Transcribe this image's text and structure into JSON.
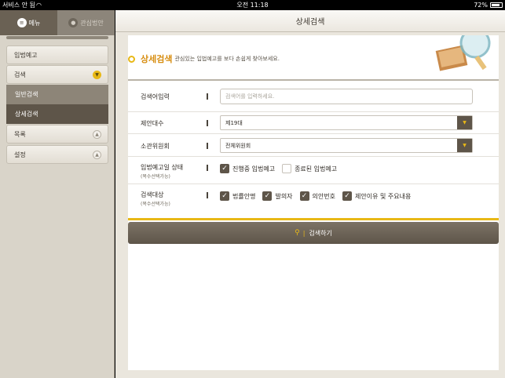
{
  "status_bar": {
    "carrier": "서비스 안 됨",
    "time": "오전 11:18",
    "battery": "72%"
  },
  "sidebar": {
    "tabs": [
      {
        "label": "메뉴",
        "icon": "list-icon"
      },
      {
        "label": "관심법안",
        "icon": "person-icon"
      }
    ],
    "items": [
      {
        "label": "입법예고"
      },
      {
        "label": "검색",
        "expanded": true
      },
      {
        "label": "목록",
        "expanded": false
      },
      {
        "label": "설정",
        "expanded": false
      }
    ],
    "sub_items": [
      {
        "label": "일반검색"
      },
      {
        "label": "상세검색",
        "selected": true
      }
    ]
  },
  "header": {
    "title": "상세검색"
  },
  "section": {
    "title": "상세검색",
    "subtitle": "관심있는 입법예고를 보다 손쉽게 찾아보세요."
  },
  "form": {
    "keyword": {
      "label": "검색어입력",
      "placeholder": "검색어를 입력하세요.",
      "value": ""
    },
    "session": {
      "label": "제안대수",
      "value": "제19대"
    },
    "committee": {
      "label": "소관위원회",
      "value": "전체위원회"
    },
    "status": {
      "label": "입법예고일 상태",
      "sublabel": "(복수선택가능)",
      "options": [
        {
          "label": "진행중 입법예고",
          "checked": true
        },
        {
          "label": "종료된 입법예고",
          "checked": false
        }
      ]
    },
    "target": {
      "label": "검색대상",
      "sublabel": "(복수선택가능)",
      "options": [
        {
          "label": "법률안명",
          "checked": true
        },
        {
          "label": "발의자",
          "checked": true
        },
        {
          "label": "의안번호",
          "checked": true
        },
        {
          "label": "제안이유 및 주요내용",
          "checked": true
        }
      ]
    },
    "submit_label": "검색하기"
  },
  "colors": {
    "accent": "#e8b816",
    "brand_dark": "#5e5549",
    "title_orange": "#d78d10"
  }
}
